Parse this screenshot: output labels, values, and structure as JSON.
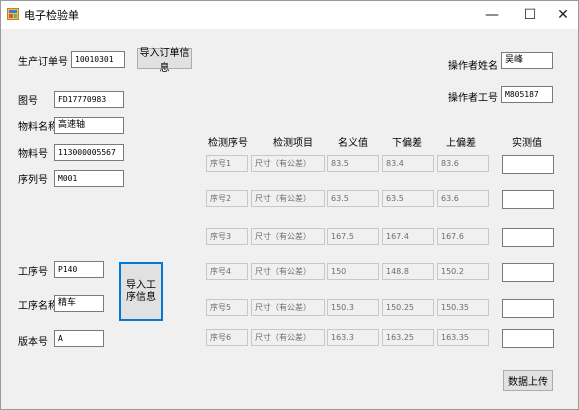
{
  "window": {
    "title": "电子检验单",
    "icon": "form-app-icon",
    "controls": {
      "minimize": "—",
      "maximize": "☐",
      "close": "✕"
    }
  },
  "order": {
    "label": "生产订单号",
    "value": "10010301",
    "import_button": "导入订单信息"
  },
  "part": {
    "drawing_no": {
      "label": "图号",
      "value": "FD17770983"
    },
    "material_name": {
      "label": "物料名称",
      "value": "高速轴"
    },
    "material_no": {
      "label": "物料号",
      "value": "113000005567"
    },
    "serial_no": {
      "label": "序列号",
      "value": "M001"
    }
  },
  "operator": {
    "name": {
      "label": "操作者姓名",
      "value": "吴峰"
    },
    "id": {
      "label": "操作者工号",
      "value": "M805187"
    }
  },
  "process": {
    "step_no": {
      "label": "工序号",
      "value": "P140"
    },
    "step_name": {
      "label": "工序名称",
      "value": "精车"
    },
    "version": {
      "label": "版本号",
      "value": "A"
    },
    "import_button": "导入工序信息"
  },
  "inspection": {
    "headers": [
      "检测序号",
      "检测项目",
      "名义值",
      "下偏差",
      "上偏差",
      "实测值"
    ],
    "rows": [
      {
        "seq": "序号1",
        "item": "尺寸（有公差）",
        "nominal": "83.5",
        "lower": "83.4",
        "upper": "83.6",
        "actual": ""
      },
      {
        "seq": "序号2",
        "item": "尺寸（有公差）",
        "nominal": "63.5",
        "lower": "63.5",
        "upper": "63.6",
        "actual": ""
      },
      {
        "seq": "序号3",
        "item": "尺寸（有公差）",
        "nominal": "167.5",
        "lower": "167.4",
        "upper": "167.6",
        "actual": ""
      },
      {
        "seq": "序号4",
        "item": "尺寸（有公差）",
        "nominal": "150",
        "lower": "148.8",
        "upper": "150.2",
        "actual": ""
      },
      {
        "seq": "序号5",
        "item": "尺寸（有公差）",
        "nominal": "150.3",
        "lower": "150.25",
        "upper": "150.35",
        "actual": ""
      },
      {
        "seq": "序号6",
        "item": "尺寸（有公差）",
        "nominal": "163.3",
        "lower": "163.25",
        "upper": "163.35",
        "actual": ""
      }
    ]
  },
  "upload_button": "数据上传"
}
